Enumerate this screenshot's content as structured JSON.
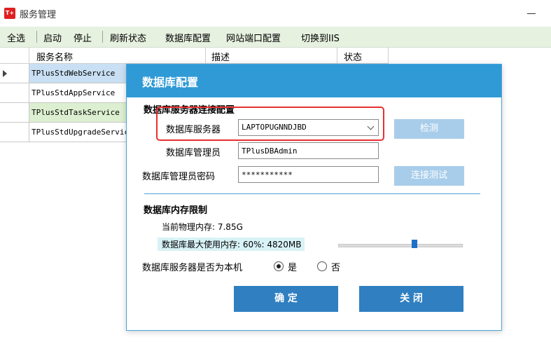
{
  "window": {
    "title": "服务管理",
    "logo_text": "T+"
  },
  "toolbar": {
    "select_all": "全选",
    "start": "启动",
    "stop": "停止",
    "refresh": "刷新状态",
    "db_config": "数据库配置",
    "port_config": "网站端口配置",
    "switch_iis": "切换到IIS"
  },
  "grid": {
    "columns": [
      "服务名称",
      "描述",
      "状态"
    ],
    "rows": [
      "TPlusStdWebService",
      "TPlusStdAppService",
      "TPlusStdTaskService",
      "TPlusStdUpgradeService"
    ]
  },
  "dialog": {
    "title": "数据库配置",
    "conn_section": "数据库服务器连接配置",
    "server_label": "数据库服务器",
    "server_value": "LAPTOPUGNNDJBD",
    "admin_label": "数据库管理员",
    "admin_value": "TPlusDBAdmin",
    "password_label": "数据库管理员密码",
    "password_value": "***********",
    "detect_button": "检测",
    "test_button": "连接测试",
    "mem_section": "数据库内存限制",
    "physical_mem": "当前物理内存: 7.85G",
    "max_mem": "数据库最大使用内存: 60%: 4820MB",
    "max_mem_percent": 60,
    "local_question": "数据库服务器是否为本机",
    "yes": "是",
    "no": "否",
    "ok_button": "确 定",
    "close_button": "关 闭"
  },
  "colors": {
    "header_blue": "#2f9ad6",
    "toolbar_green": "#e7f1e0",
    "highlight_red": "#e83030"
  }
}
